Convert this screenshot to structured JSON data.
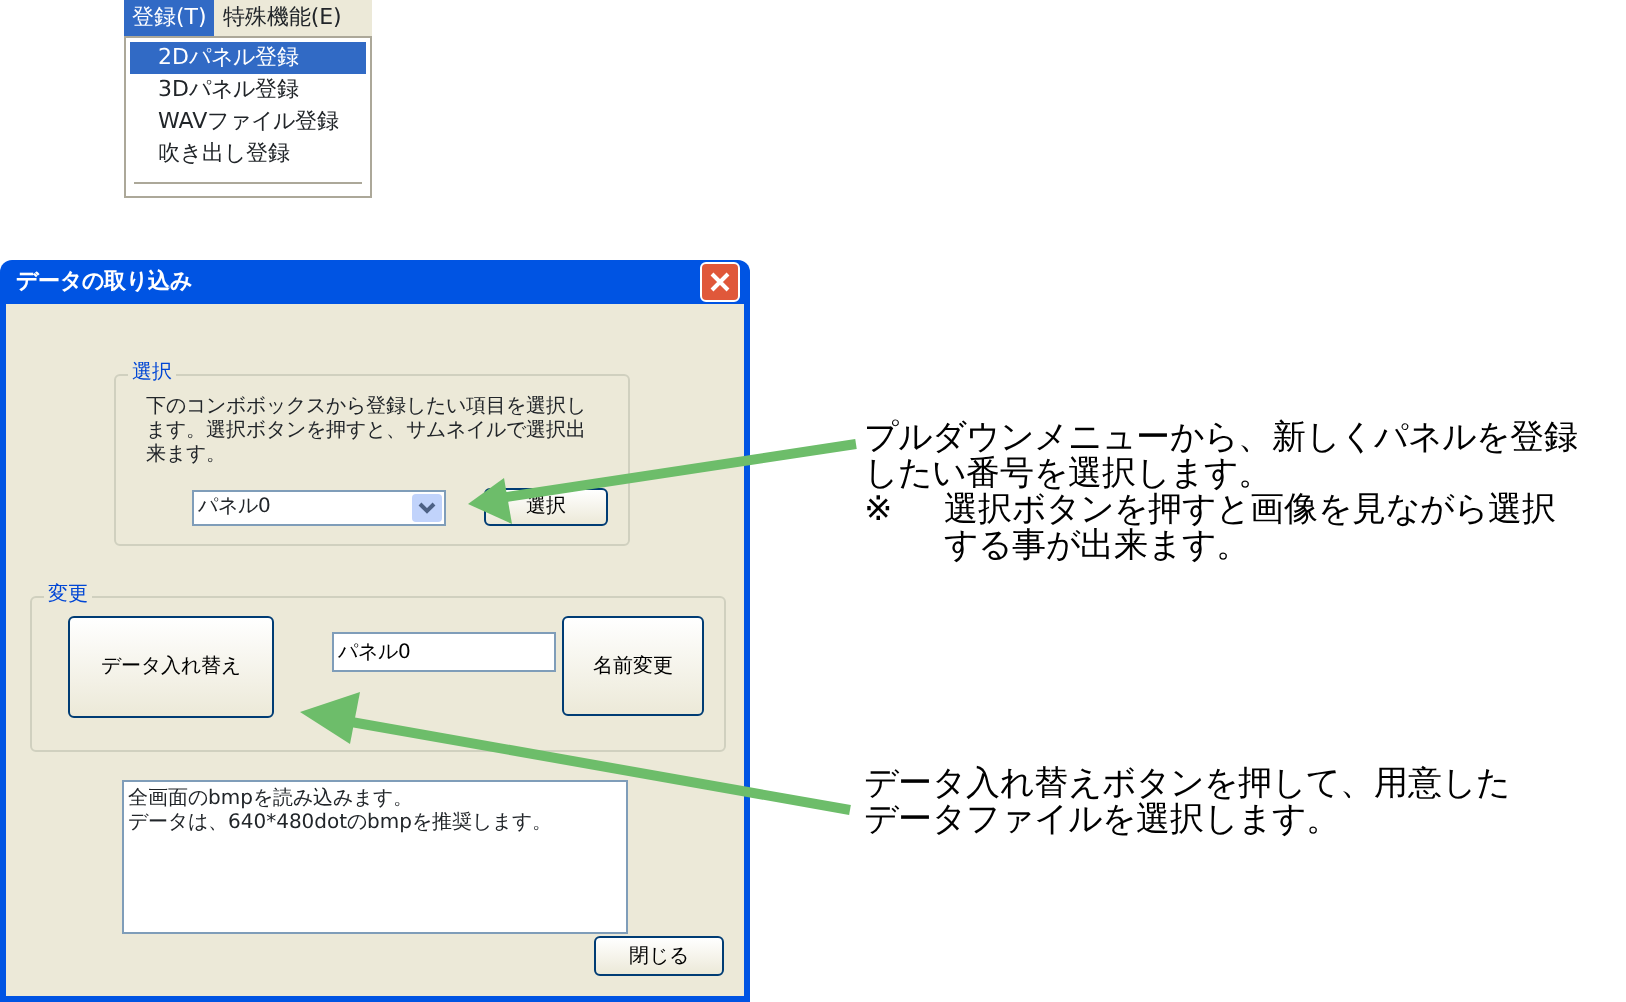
{
  "menu": {
    "items": [
      {
        "label": "登録(T)",
        "selected": true
      },
      {
        "label": "特殊機能(E)",
        "selected": false
      }
    ],
    "dropdown": [
      {
        "label": "2Dパネル登録",
        "selected": true
      },
      {
        "label": "3Dパネル登録",
        "selected": false
      },
      {
        "label": "WAVファイル登録",
        "selected": false
      },
      {
        "label": "吹き出し登録",
        "selected": false
      }
    ]
  },
  "dialog": {
    "title": "データの取り込み",
    "select_group": {
      "title": "選択",
      "description": "下のコンボボックスから登録したい項目を選択します。選択ボタンを押すと、サムネイルで選択出来ます。",
      "combo_value": "パネル0",
      "button": "選択"
    },
    "change_group": {
      "title": "変更",
      "swap_button": "データ入れ替え",
      "name_value": "パネル0",
      "rename_button": "名前変更"
    },
    "info": [
      "全画面のbmpを読み込みます。",
      "データは、640*480dotのbmpを推奨します。"
    ],
    "close_button": "閉じる"
  },
  "callouts": [
    {
      "text": "プルダウンメニューから、新しくパネルを登録したい番号を選択します。",
      "note_mark": "※",
      "note": "選択ボタンを押すと画像を見ながら選択する事が出来ます。"
    },
    {
      "text": "データ入れ替えボタンを押して、用意したデータファイルを選択します。"
    }
  ]
}
